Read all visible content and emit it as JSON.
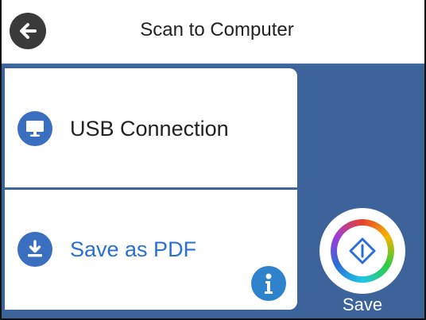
{
  "header": {
    "title": "Scan to Computer",
    "back_icon": "arrow-left-icon"
  },
  "options": [
    {
      "label": "USB Connection",
      "icon": "monitor-icon",
      "label_color": "#222222"
    },
    {
      "label": "Save as PDF",
      "icon": "download-icon",
      "label_color": "#2a6fd6"
    }
  ],
  "info_icon": "info-icon",
  "save": {
    "label": "Save",
    "icon": "start-diamond-icon"
  },
  "colors": {
    "accent_blue": "#3d639b",
    "icon_blue": "#3a6fc0",
    "link_blue": "#2a6fd6",
    "info_blue": "#2f82cc"
  }
}
